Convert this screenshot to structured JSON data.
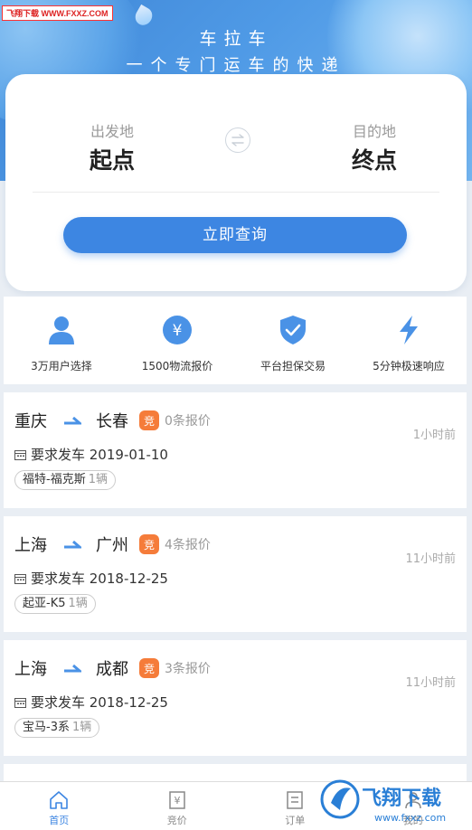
{
  "watermark": "飞翔下载 WWW.FXXZ.COM",
  "brand": {
    "title": "车拉车",
    "subtitle": "一个专门运车的快递"
  },
  "search": {
    "from_label": "出发地",
    "from_value": "起点",
    "to_label": "目的地",
    "to_value": "终点",
    "button": "立即查询"
  },
  "features": [
    {
      "icon": "user-icon",
      "label": "3万用户选择"
    },
    {
      "icon": "yen-icon",
      "label": "1500物流报价"
    },
    {
      "icon": "shield-check-icon",
      "label": "平台担保交易"
    },
    {
      "icon": "lightning-icon",
      "label": "5分钟极速响应"
    }
  ],
  "orders": [
    {
      "from": "重庆",
      "to": "长春",
      "badge": "竞",
      "bids": "0条报价",
      "ago": "1小时前",
      "date": "要求发车 2019-01-10",
      "car": "福特-福克斯",
      "count": "1辆"
    },
    {
      "from": "上海",
      "to": "广州",
      "badge": "竞",
      "bids": "4条报价",
      "ago": "11小时前",
      "date": "要求发车 2018-12-25",
      "car": "起亚-K5",
      "count": "1辆"
    },
    {
      "from": "上海",
      "to": "成都",
      "badge": "竞",
      "bids": "3条报价",
      "ago": "11小时前",
      "date": "要求发车 2018-12-25",
      "car": "宝马-3系",
      "count": "1辆"
    }
  ],
  "nav": [
    {
      "icon": "home-icon",
      "label": "首页",
      "active": true
    },
    {
      "icon": "bid-icon",
      "label": "竞价",
      "active": false
    },
    {
      "icon": "orders-icon",
      "label": "订单",
      "active": false
    },
    {
      "icon": "profile-icon",
      "label": "我的",
      "active": false
    }
  ],
  "watermark_logo": "飞翔下载 www.fxxz.com",
  "colors": {
    "primary": "#3d86e2",
    "badge": "#f57c3a",
    "background": "#e9eef4"
  }
}
